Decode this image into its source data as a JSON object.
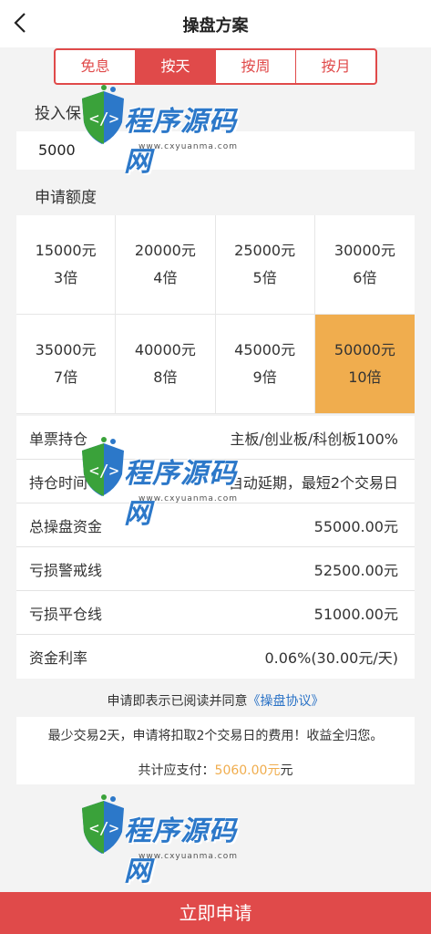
{
  "header": {
    "title": "操盘方案"
  },
  "tabs": [
    {
      "label": "免息",
      "active": false
    },
    {
      "label": "按天",
      "active": true
    },
    {
      "label": "按周",
      "active": false
    },
    {
      "label": "按月",
      "active": false
    }
  ],
  "invest": {
    "label": "投入保",
    "value": "5000"
  },
  "apply": {
    "label": "申请额度"
  },
  "options": [
    {
      "amount": "15000元",
      "multiple": "3倍"
    },
    {
      "amount": "20000元",
      "multiple": "4倍"
    },
    {
      "amount": "25000元",
      "multiple": "5倍"
    },
    {
      "amount": "30000元",
      "multiple": "6倍"
    },
    {
      "amount": "35000元",
      "multiple": "7倍"
    },
    {
      "amount": "40000元",
      "multiple": "8倍"
    },
    {
      "amount": "45000元",
      "multiple": "9倍"
    },
    {
      "amount": "50000元",
      "multiple": "10倍"
    }
  ],
  "selected_index": 7,
  "info": [
    {
      "label": "单票持仓",
      "value": "主板/创业板/科创板100%"
    },
    {
      "label": "持仓时间",
      "value": "自动延期，最短2个交易日"
    },
    {
      "label": "总操盘资金",
      "value": "55000.00元"
    },
    {
      "label": "亏损警戒线",
      "value": "52500.00元"
    },
    {
      "label": "亏损平仓线",
      "value": "51000.00元"
    },
    {
      "label": "资金利率",
      "value": "0.06%(30.00元/天)"
    }
  ],
  "agreement": {
    "prefix": "申请即表示已阅读并同意",
    "link": "《操盘协议》"
  },
  "notice": {
    "line1": "最少交易2天，申请将扣取2个交易日的费用！收益全归您。",
    "total_label": "共计应支付：",
    "total_amount": "5060.00元",
    "total_suffix": "元"
  },
  "watermark": {
    "text": "程序源码网",
    "url": "www.cxyuanma.com"
  },
  "submit": {
    "label": "立即申请"
  },
  "colors": {
    "accent": "#e04a4a",
    "selected": "#f0ad4e",
    "link": "#2a72c6"
  }
}
